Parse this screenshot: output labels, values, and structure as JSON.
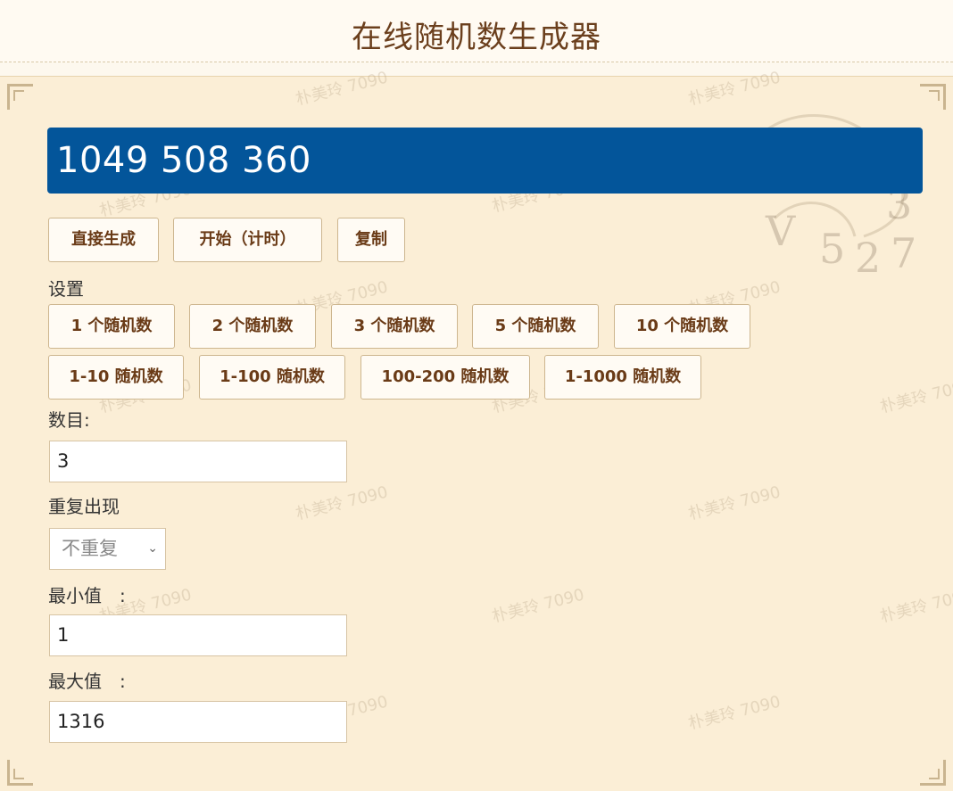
{
  "page": {
    "title": "在线随机数生成器"
  },
  "watermark": "朴美玲 7090",
  "result": {
    "value": "1049 508 360"
  },
  "actions": {
    "direct_generate": "直接生成",
    "start_timed": "开始（计时）",
    "copy": "复制"
  },
  "settings": {
    "label": "设置",
    "presets_row1": [
      "1 个随机数",
      "2 个随机数",
      "3 个随机数",
      "5 个随机数",
      "10 个随机数"
    ],
    "presets_row2": [
      "1-10 随机数",
      "1-100 随机数",
      "100-200 随机数",
      "1-1000 随机数"
    ]
  },
  "form": {
    "count_label": "数目:",
    "count_value": "3",
    "repeat_label": "重复出现",
    "repeat_selected": "不重复",
    "min_label": "最小值　:",
    "min_value": "1",
    "max_label": "最大值　:",
    "max_value": "1316"
  },
  "colors": {
    "result_bg": "#03559a",
    "panel_bg": "#fbeed6",
    "button_text": "#6a3b17"
  },
  "icons": {
    "select_chevron": "chevron-down-icon"
  }
}
